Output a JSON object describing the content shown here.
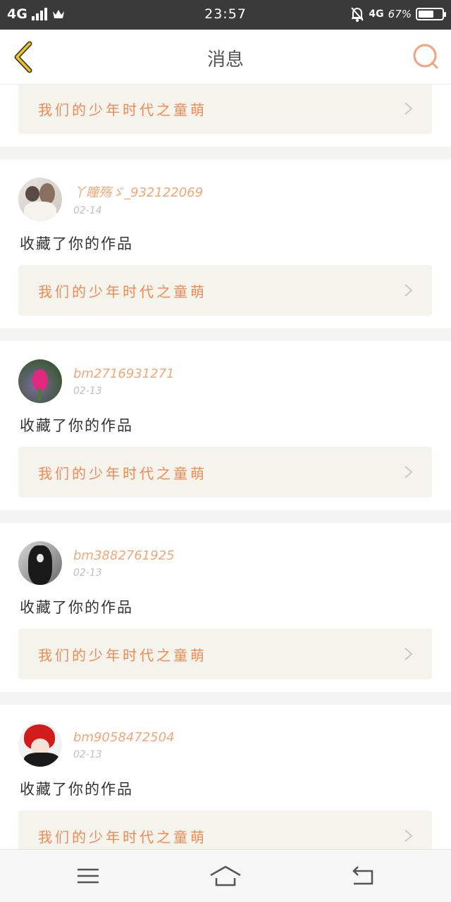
{
  "status_bar": {
    "network": "4G",
    "time": "23:57",
    "right_network": "4G",
    "battery": "67%",
    "battery_level": 0.67
  },
  "nav": {
    "title": "消息"
  },
  "work_title": "我们的少年时代之童萌",
  "messages": [
    {
      "username": "丫瞳殇ゞ_932122069",
      "date": "02-14",
      "action": "收藏了你的作品",
      "work": "我们的少年时代之童萌"
    },
    {
      "username": "bm2716931271",
      "date": "02-13",
      "action": "收藏了你的作品",
      "work": "我们的少年时代之童萌"
    },
    {
      "username": "bm3882761925",
      "date": "02-13",
      "action": "收藏了你的作品",
      "work": "我们的少年时代之童萌"
    },
    {
      "username": "bm9058472504",
      "date": "02-13",
      "action": "收藏了你的作品",
      "work": "我们的少年时代之童萌"
    }
  ],
  "colors": {
    "accent": "#f08a56",
    "username": "#f0a878",
    "link_bg": "#f4f3ec",
    "back_icon": "#e8b818"
  },
  "icons": {
    "back": "chevron-left-icon",
    "search": "search-icon",
    "menu": "menu-icon",
    "home": "home-icon",
    "return": "return-icon"
  }
}
